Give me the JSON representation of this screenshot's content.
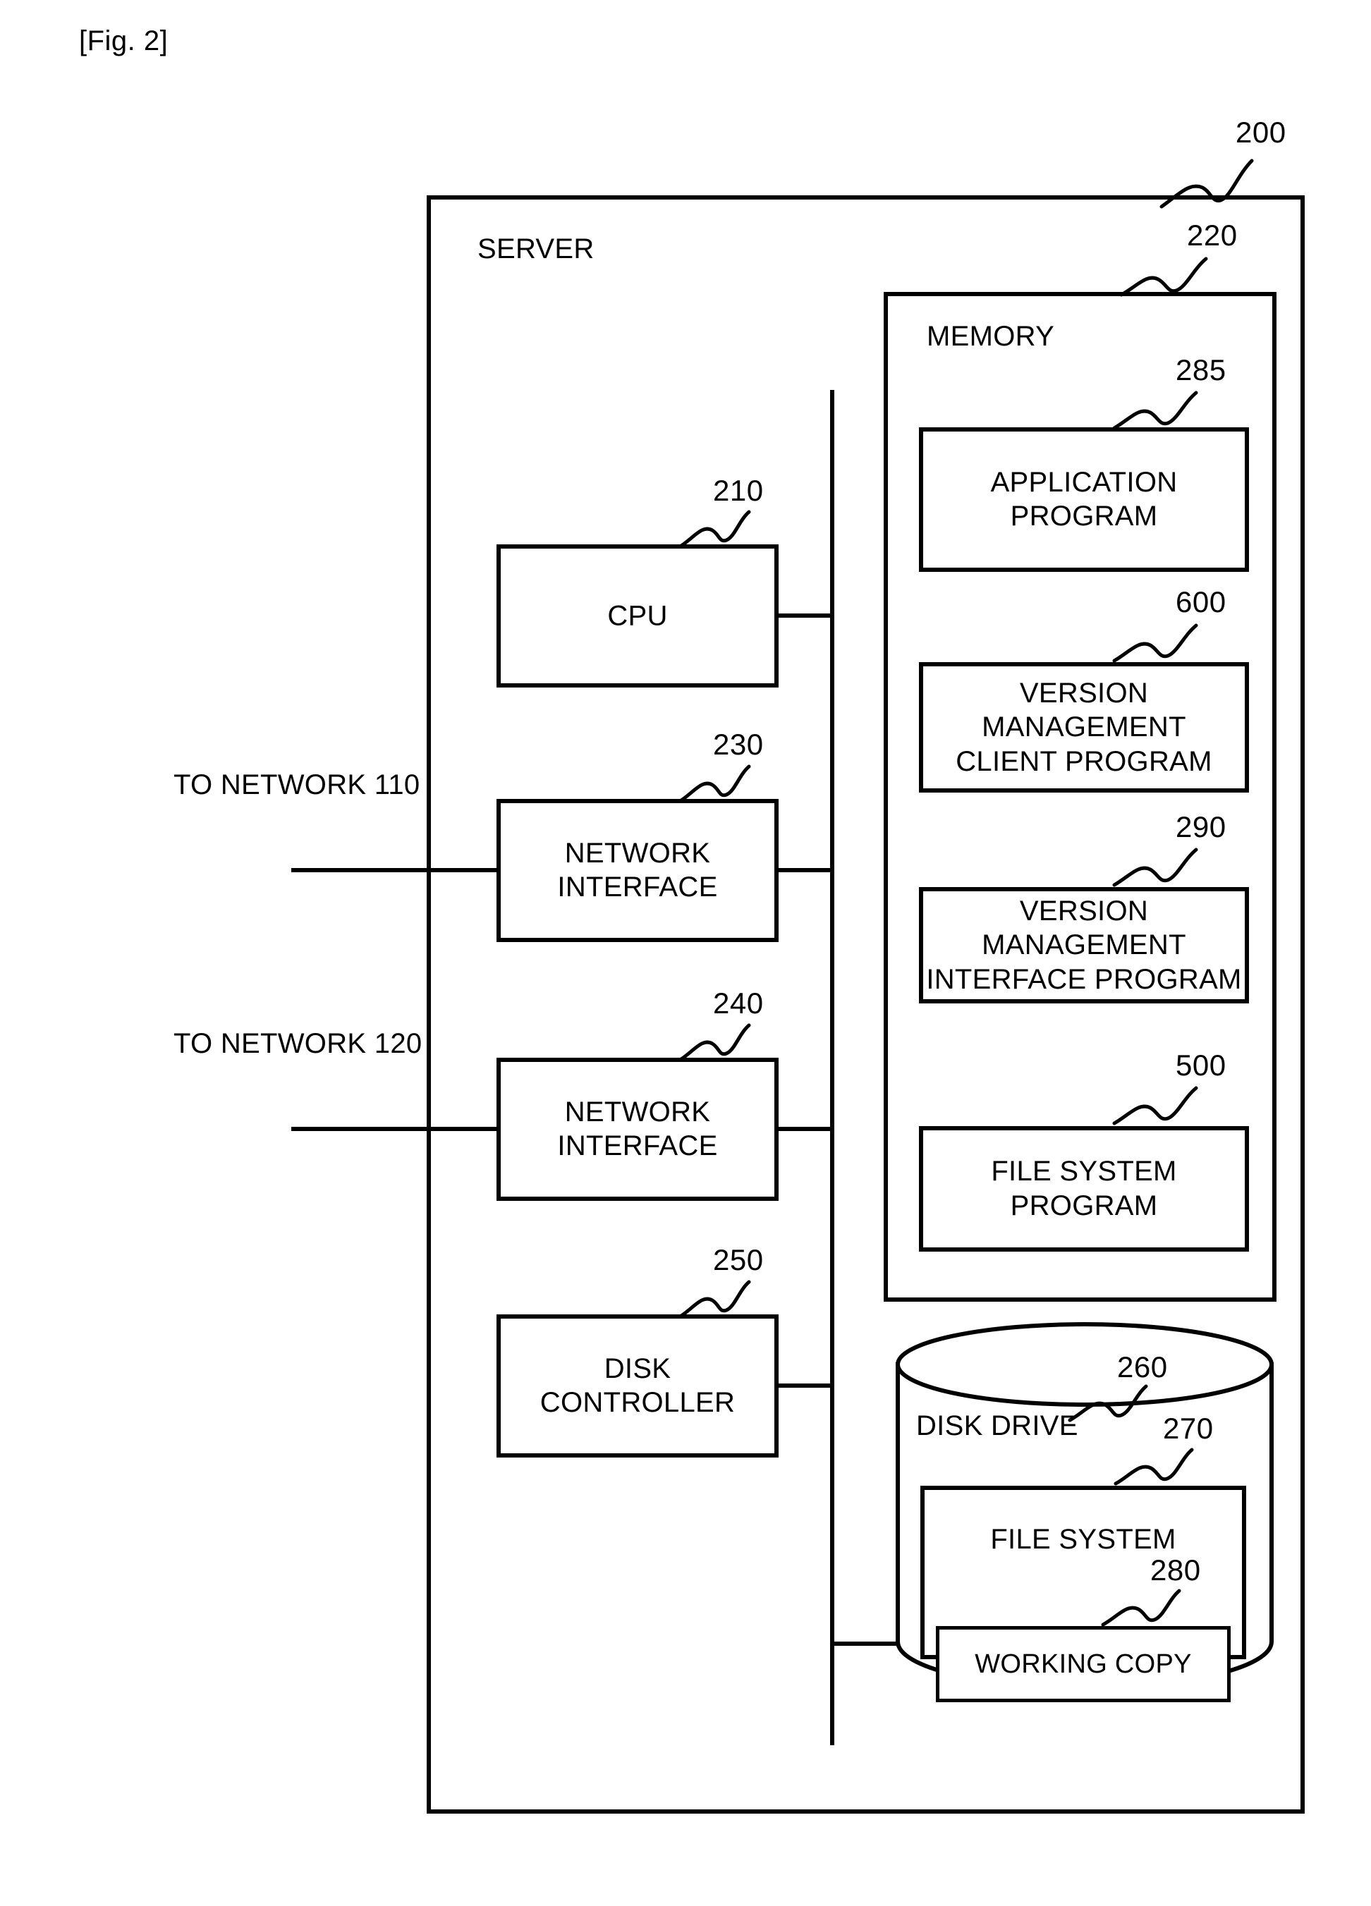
{
  "figure": {
    "caption": "[Fig. 2]",
    "title": "SERVER"
  },
  "outer": {
    "server_label": "SERVER",
    "server_ref": "200"
  },
  "memory": {
    "label": "MEMORY",
    "ref": "220",
    "programs": [
      {
        "name": "application-program",
        "label": "APPLICATION\nPROGRAM",
        "ref": "285"
      },
      {
        "name": "version-management-client-program",
        "label": "VERSION\nMANAGEMENT\nCLIENT PROGRAM",
        "ref": "600"
      },
      {
        "name": "version-management-interface-program",
        "label": "VERSION\nMANAGEMENT\nINTERFACE PROGRAM",
        "ref": "290"
      },
      {
        "name": "file-system-program",
        "label": "FILE SYSTEM\nPROGRAM",
        "ref": "500"
      }
    ]
  },
  "components": [
    {
      "name": "cpu",
      "label": "CPU",
      "ref": "210"
    },
    {
      "name": "network-interface-110",
      "label": "NETWORK\nINTERFACE",
      "ref": "230"
    },
    {
      "name": "network-interface-120",
      "label": "NETWORK\nINTERFACE",
      "ref": "240"
    },
    {
      "name": "disk-controller",
      "label": "DISK\nCONTROLLER",
      "ref": "250"
    }
  ],
  "network_links": [
    {
      "name": "to-network-110",
      "label": "TO NETWORK 110"
    },
    {
      "name": "to-network-120",
      "label": "TO NETWORK 120"
    }
  ],
  "disk_drive": {
    "label": "DISK DRIVE",
    "ref": "260",
    "file_system": {
      "label": "FILE SYSTEM",
      "ref": "270"
    },
    "working_copy": {
      "label": "WORKING COPY",
      "ref": "280"
    }
  },
  "colors": {
    "line": "#000000",
    "background": "#ffffff"
  }
}
